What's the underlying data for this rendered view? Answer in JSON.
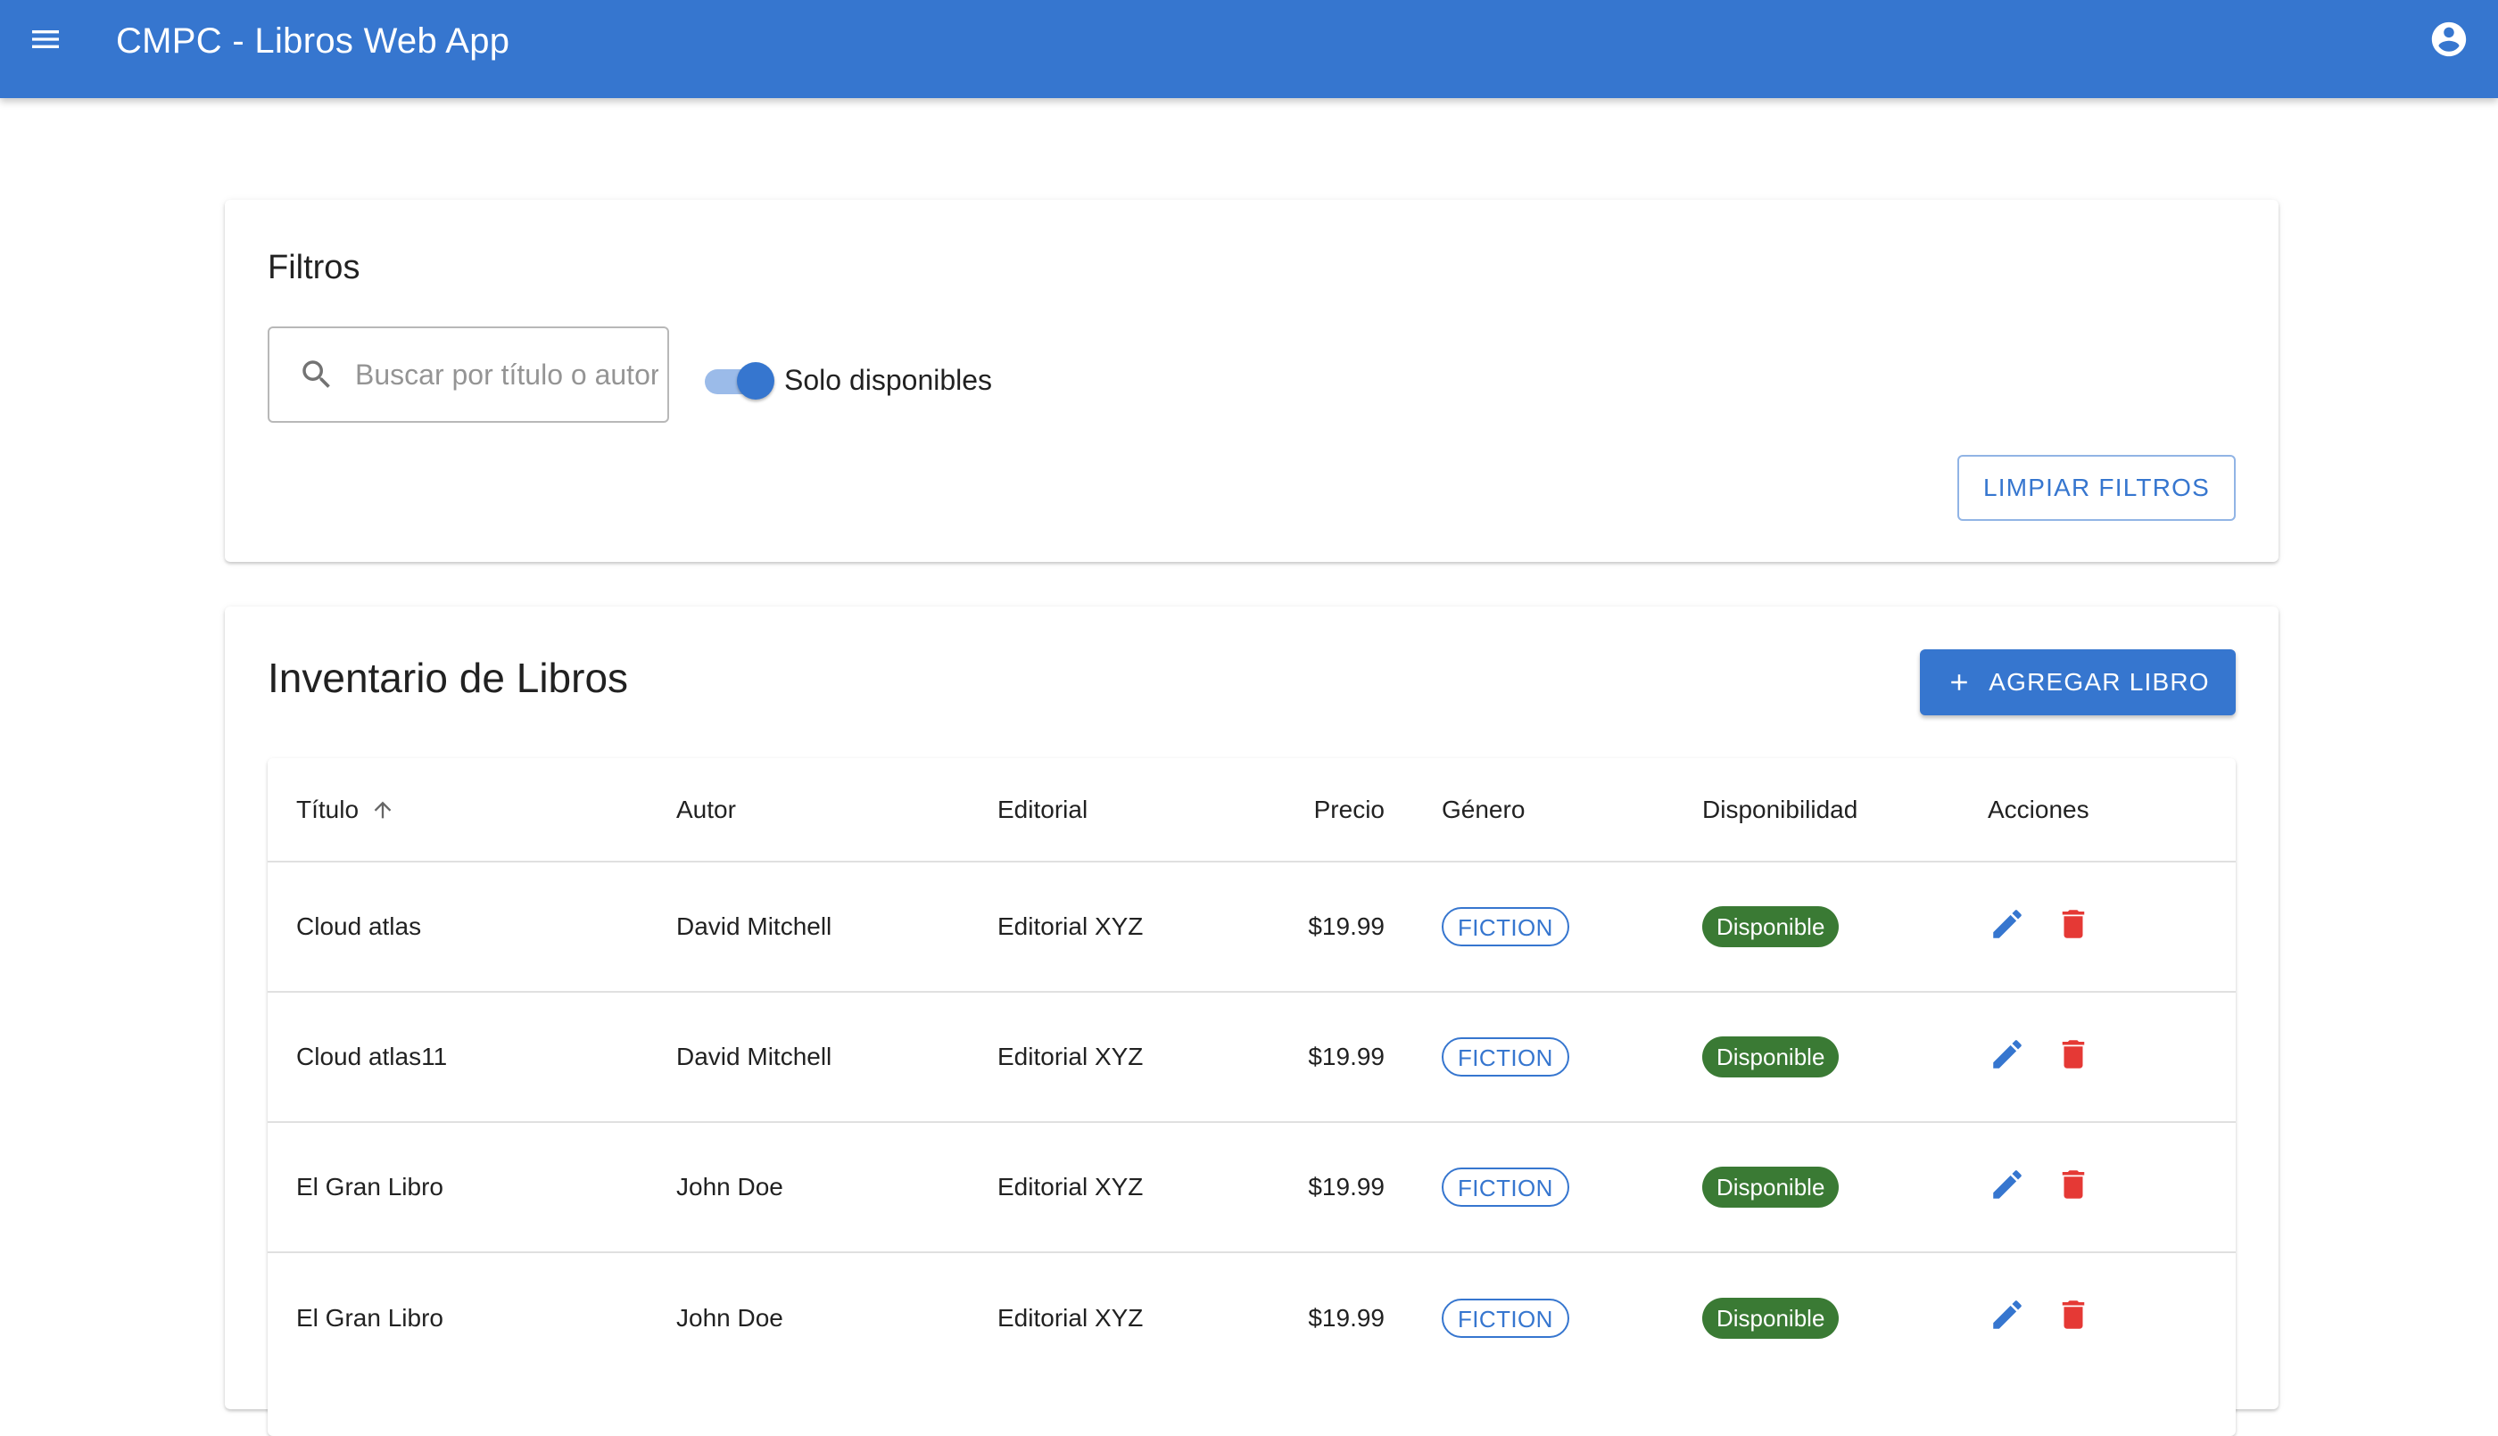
{
  "app": {
    "title": "CMPC - Libros Web App",
    "accent_color": "#3676cf"
  },
  "icons": {
    "menu": "menu-icon",
    "account": "account-circle-icon",
    "search": "search-icon",
    "sort": "arrow-up-icon",
    "add": "plus-icon",
    "edit": "pencil-icon",
    "delete": "trash-icon"
  },
  "filters": {
    "title": "Filtros",
    "search_placeholder": "Buscar por título o autor",
    "search_value": "",
    "switch_label": "Solo disponibles",
    "switch_on": true,
    "clear_label": "LIMPIAR FILTROS"
  },
  "inventory": {
    "title": "Inventario de Libros",
    "add_label": "AGREGAR LIBRO",
    "columns": {
      "titulo": "Título",
      "autor": "Autor",
      "editorial": "Editorial",
      "precio": "Precio",
      "genero": "Género",
      "disponibilidad": "Disponibilidad",
      "acciones": "Acciones"
    },
    "sort": {
      "column": "titulo",
      "direction": "asc"
    },
    "rows": [
      {
        "titulo": "Cloud atlas",
        "autor": "David Mitchell",
        "editorial": "Editorial XYZ",
        "precio": "$19.99",
        "genero": "FICTION",
        "disponibilidad": "Disponible"
      },
      {
        "titulo": "Cloud atlas11",
        "autor": "David Mitchell",
        "editorial": "Editorial XYZ",
        "precio": "$19.99",
        "genero": "FICTION",
        "disponibilidad": "Disponible"
      },
      {
        "titulo": "El Gran Libro",
        "autor": "John Doe",
        "editorial": "Editorial XYZ",
        "precio": "$19.99",
        "genero": "FICTION",
        "disponibilidad": "Disponible"
      },
      {
        "titulo": "El Gran Libro",
        "autor": "John Doe",
        "editorial": "Editorial XYZ",
        "precio": "$19.99",
        "genero": "FICTION",
        "disponibilidad": "Disponible"
      }
    ]
  },
  "colors": {
    "appbar": "#3676cf",
    "available": "#3a7a34",
    "delete": "#e53935"
  }
}
